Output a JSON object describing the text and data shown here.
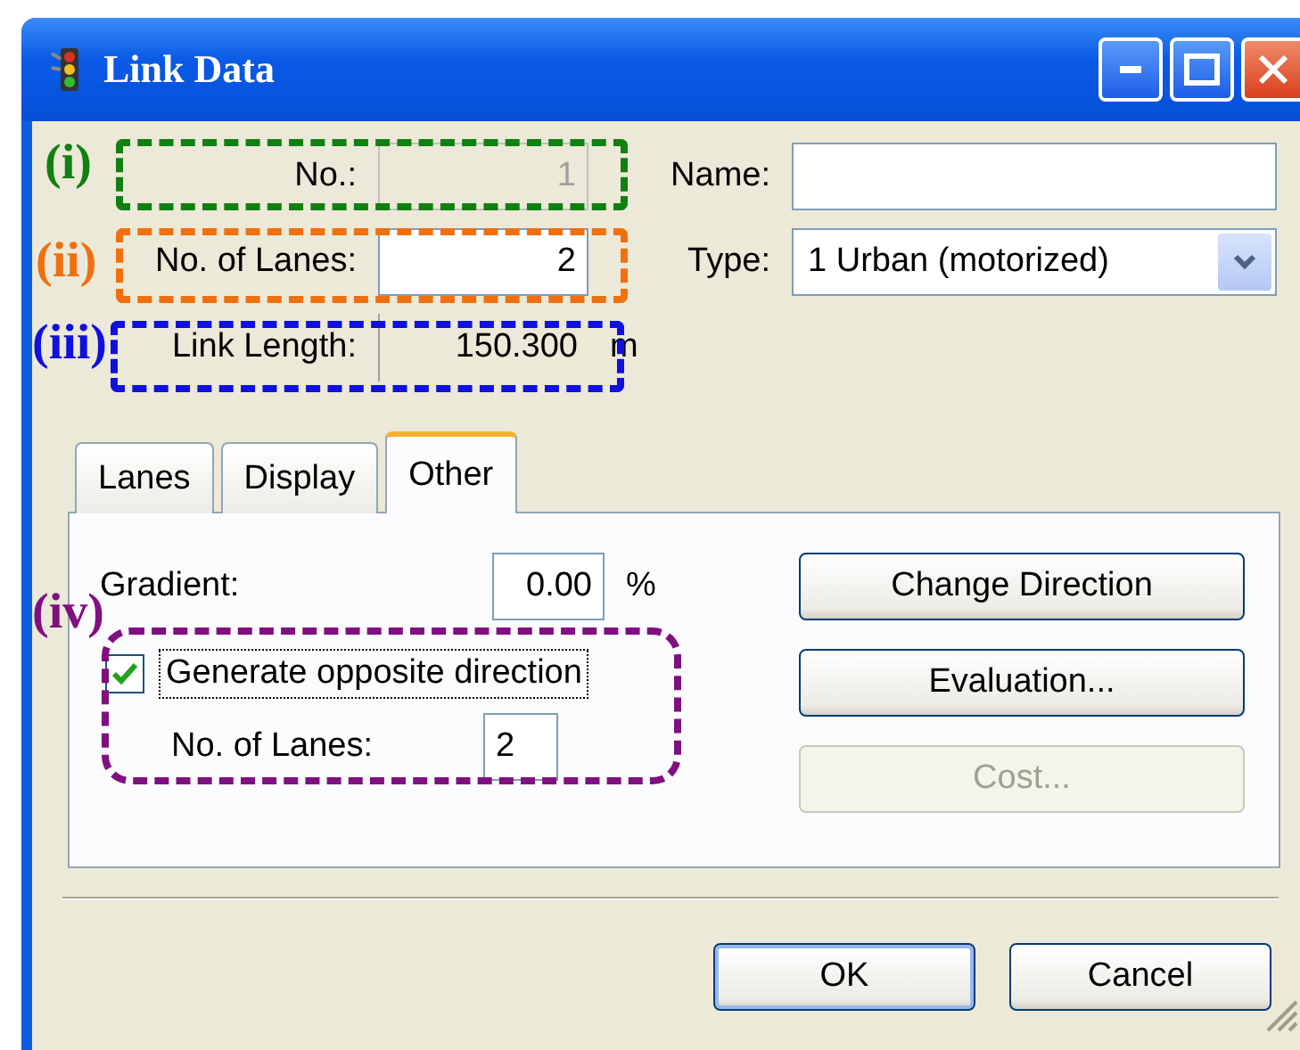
{
  "window": {
    "title": "Link Data"
  },
  "fields": [
    {
      "label": "No.:",
      "value": "1",
      "kind": "input",
      "disabled": true
    },
    {
      "label": "No. of Lanes:",
      "value": "2",
      "kind": "input",
      "disabled": false
    },
    {
      "label": "Link Length:",
      "value": "150.300",
      "kind": "readonly",
      "unit": "m"
    }
  ],
  "name_field": {
    "label": "Name:"
  },
  "type_field": {
    "label": "Type:",
    "value": "1 Urban (motorized)"
  },
  "tabs": [
    {
      "label": "Lanes",
      "selected": false
    },
    {
      "label": "Display",
      "selected": false
    },
    {
      "label": "Other",
      "selected": true
    }
  ],
  "gradient": {
    "label": "Gradient:",
    "value": "0.00",
    "unit": "%"
  },
  "opposite": {
    "label": "Generate opposite direction",
    "checked": true,
    "focused": true
  },
  "opposite_lanes": {
    "label": "No. of Lanes:",
    "value": "2"
  },
  "side_buttons": [
    {
      "label": "Change Direction",
      "disabled": false
    },
    {
      "label": "Evaluation...",
      "disabled": false
    },
    {
      "label": "Cost...",
      "disabled": true
    }
  ],
  "footer_buttons": [
    {
      "label": "OK",
      "default": true
    },
    {
      "label": "Cancel",
      "default": false
    }
  ],
  "annotations": [
    {
      "label": "(i)",
      "color": "#108010"
    },
    {
      "label": "(ii)",
      "color": "#f07010"
    },
    {
      "label": "(iii)",
      "color": "#1010e0"
    },
    {
      "label": "(iv)",
      "color": "#801080"
    }
  ]
}
